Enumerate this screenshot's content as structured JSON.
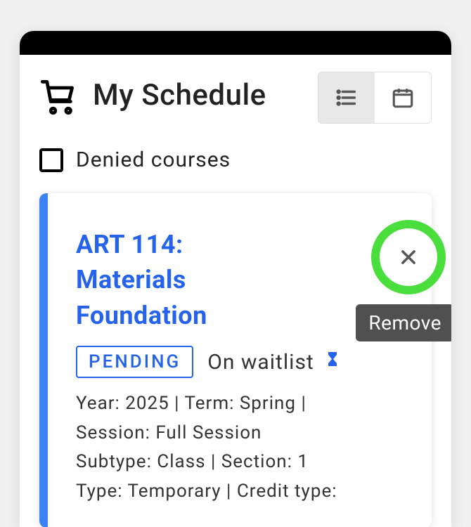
{
  "header": {
    "title": "My Schedule"
  },
  "denied": {
    "label": "Denied courses"
  },
  "course": {
    "title": "ART 114: Materials Foundation",
    "status_badge": "PENDING",
    "waitlist_label": "On waitlist",
    "remove_tooltip": "Remove",
    "details_line1": "Year: 2025 | Term: Spring |",
    "details_line2": "Session: Full Session",
    "details_line3": "Subtype: Class | Section: 1",
    "details_line4": "Type: Temporary | Credit type:"
  }
}
